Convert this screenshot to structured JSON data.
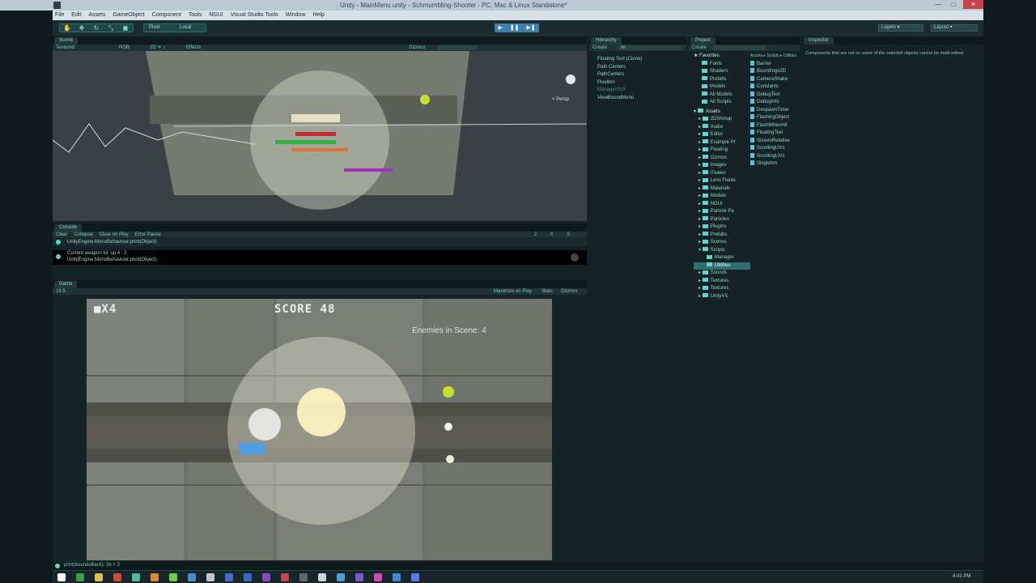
{
  "window": {
    "title": "Unity - MainMenu.unity - Schmumbling-Shooter - PC, Mac & Linux Standalone*",
    "controls": [
      "—",
      "□",
      "✕"
    ]
  },
  "menu": [
    "File",
    "Edit",
    "Assets",
    "GameObject",
    "Component",
    "Tools",
    "NGUI",
    "Visual Studio Tools",
    "Window",
    "Help"
  ],
  "toolbar": {
    "pivot_label": "Pivot",
    "space_label": "Local",
    "layers_label": "Layers",
    "layout_label": "Layout",
    "play_icons": [
      "▶",
      "❚❚",
      "▶❚"
    ]
  },
  "scene": {
    "tab": "Scene",
    "shading_mode": "Textured",
    "render_mode": "RGB",
    "effects_label": "Effects",
    "gizmos_label": "Gizmos",
    "persp_label": "< Persp"
  },
  "console": {
    "tab": "Console",
    "buttons": [
      "Clear",
      "Collapse",
      "Clear on Play",
      "Error Pause"
    ],
    "counts": [
      "2",
      "0",
      "0"
    ],
    "entries": [
      {
        "line1": "UnityEngine.MonoBehaviour:print(Object)",
        "line2": ""
      },
      {
        "line1": "Current weapon lvl: up 4 : 2",
        "line2": "UnityEngine.MonoBehaviour:print(Object)"
      }
    ]
  },
  "game": {
    "tab": "Game",
    "aspect": "16:9",
    "maximize_label": "Maximize on Play",
    "stats_label": "Stats",
    "gizmos_label": "Gizmos",
    "lives": "■X4",
    "score": "SCORE 48",
    "enemies": "Enemies in Scene: 4"
  },
  "hierarchy": {
    "tab": "Hierarchy",
    "create_label": "Create",
    "search_placeholder": "All",
    "items": [
      "Floating Text (Clone)",
      "Path Centers",
      "PathCenters",
      "Pixelbrn",
      "ManagerGUI",
      "ViewBoundMono"
    ]
  },
  "project": {
    "tab": "Project",
    "create_label": "Create",
    "breadcrumb": "Assets ▸ Scripts ▸ Utilities",
    "favorites_label": "Favorites",
    "favorites": [
      "Fonts",
      "Shaders",
      "Prefabs",
      "Models",
      "All Models",
      "All Scripts"
    ],
    "assets_label": "Assets",
    "folders": [
      "2DShmup",
      "Audio",
      "Editor",
      "Example Pr",
      "Floating",
      "Gizmos",
      "Images",
      "iTween",
      "Lens Flares",
      "Materials",
      "Models",
      "NGUI",
      "Particle Pa",
      "Particles",
      "Plugins",
      "Prefabs",
      "Scenes",
      "Scripts",
      "Manager",
      "Utilities",
      "Sounds",
      "Textures",
      "Textures",
      "UnityVS"
    ],
    "files": [
      "Barrier",
      "Boundings2D",
      "CameraShake",
      "Constants",
      "DebugText",
      "DebugInfo",
      "DespawnTimer",
      "FlashingObject",
      "FlashWhenHit",
      "FloatingText",
      "ScreenRelative",
      "ScrollingUVs",
      "ScrollingUVs",
      "Singleton"
    ]
  },
  "inspector": {
    "tab": "Inspector",
    "message": "Components that are not on some of the selected objects cannot be multi-edited."
  },
  "status": {
    "message": "print(boundsBack): 36 × 3"
  },
  "taskbar": {
    "time": "4:41 PM"
  },
  "colors": {
    "accent": "#2f6f73",
    "panel_bg": "#162326",
    "text": "#8fd3c8",
    "play_blue": "#3d7fa8"
  }
}
